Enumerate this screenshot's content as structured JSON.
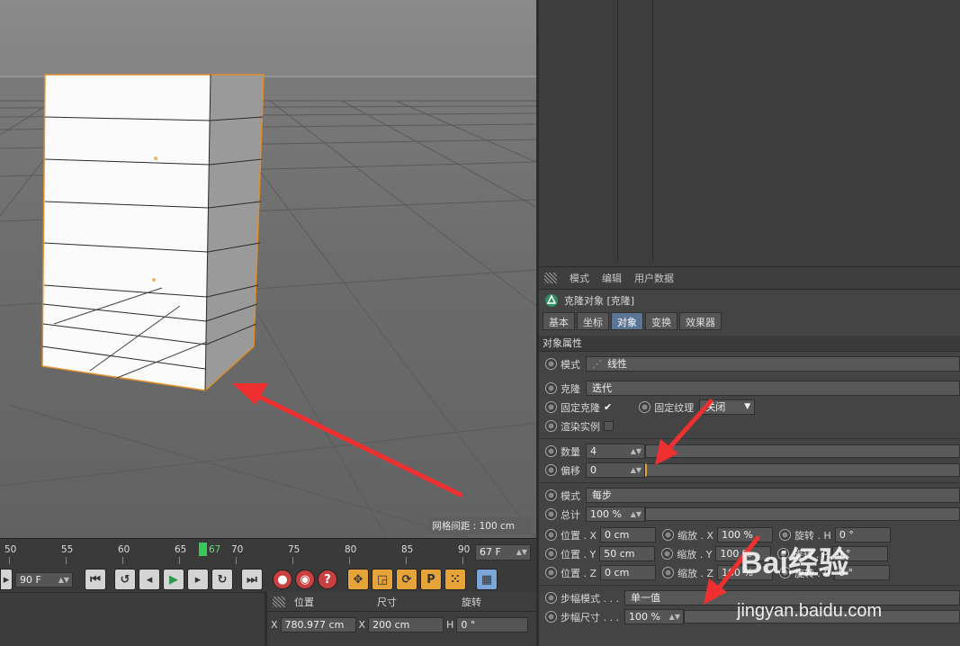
{
  "viewport": {
    "grid_spacing": "网格间距 : 100 cm"
  },
  "attributes": {
    "menu": [
      "模式",
      "编辑",
      "用户数据"
    ],
    "object_title": "克隆对象 [克隆]",
    "tabs": [
      {
        "label": "基本",
        "active": false
      },
      {
        "label": "坐标",
        "active": false
      },
      {
        "label": "对象",
        "active": true
      },
      {
        "label": "变换",
        "active": false
      },
      {
        "label": "效果器",
        "active": false
      }
    ],
    "section": "对象属性",
    "mode_label": "模式",
    "mode_value": "线性",
    "clone_label": "克隆",
    "clone_value": "迭代",
    "fix_clone_label": "固定克隆",
    "fix_clone_check": "✔",
    "fix_texture_label": "固定纹理",
    "fix_texture_value": "关闭",
    "render_instance_label": "渲染实例",
    "count_label": "数量",
    "count_value": "4",
    "offset_label": "偏移",
    "offset_value": "0",
    "mode2_label": "模式",
    "mode2_value": "每步",
    "total_label": "总计",
    "total_value": "100 %",
    "pos_x_label": "位置 . X",
    "pos_x": "0 cm",
    "pos_y_label": "位置 . Y",
    "pos_y": "50 cm",
    "pos_z_label": "位置 . Z",
    "pos_z": "0 cm",
    "scale_x_label": "缩放 . X",
    "scale_x": "100 %",
    "scale_y_label": "缩放 . Y",
    "scale_y": "100 %",
    "scale_z_label": "缩放 . Z",
    "scale_z": "100 %",
    "rot_h_label": "旋转 . H",
    "rot_h": "0 °",
    "rot_p_label": "旋转 . P",
    "rot_p": "0 °",
    "rot_b_label": "旋转 . B",
    "rot_b": "0 °",
    "step_mode_label": "步幅模式 . . .",
    "step_mode_value": "单一值",
    "step_size_label": "步幅尺寸 . . .",
    "step_size_value": "100 %"
  },
  "timeline": {
    "ticks": [
      "50",
      "55",
      "60",
      "65",
      "67",
      "70",
      "75",
      "80",
      "85",
      "90"
    ],
    "end_frame": "67 F",
    "current_frame": "90 F"
  },
  "coords": {
    "headers": [
      "位置",
      "尺寸",
      "旋转"
    ],
    "pos_x_axis": "X",
    "pos_x": "780.977 cm",
    "size_x_axis": "X",
    "size_x": "200 cm",
    "rot_h_axis": "H",
    "rot_h": "0 °"
  },
  "watermark": {
    "brand": "Bai经验",
    "url": "jingyan.baidu.com"
  },
  "colors": {
    "accent_tab": "#5b7694",
    "selection_outline": "#e0902a",
    "annotation_arrow": "#f03030",
    "playhead": "#37c85a"
  }
}
